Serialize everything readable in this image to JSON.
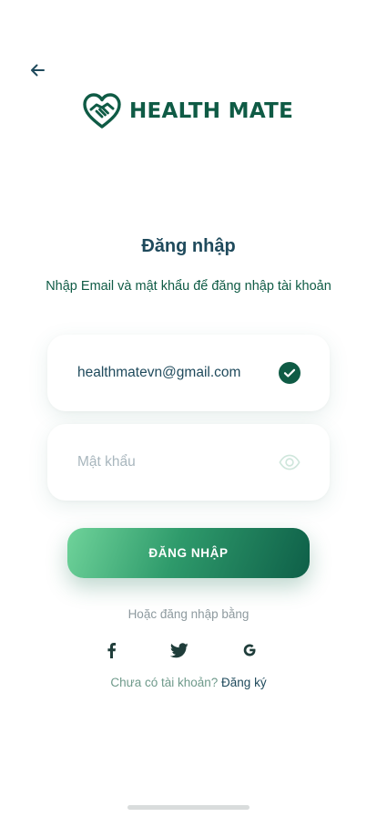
{
  "header": {
    "back_icon": "arrow-left-icon",
    "logo_text": "HEALTH MATE",
    "logo_icon": "heart-handshake-icon",
    "brand_color": "#0f5b45"
  },
  "login": {
    "title": "Đăng nhập",
    "subtitle": "Nhập Email và mật khẩu để đăng nhập tài khoản",
    "email": {
      "value": "healthmatevn@gmail.com",
      "status_icon": "check-circle-icon"
    },
    "password": {
      "placeholder": "Mật khẩu",
      "value": "",
      "toggle_icon": "eye-icon"
    },
    "submit_label": "ĐĂNG NHẬP"
  },
  "social": {
    "label": "Hoặc đăng nhập bằng",
    "providers": [
      {
        "name": "facebook",
        "icon": "facebook-icon"
      },
      {
        "name": "twitter",
        "icon": "twitter-icon"
      },
      {
        "name": "google",
        "icon": "google-icon"
      }
    ]
  },
  "signup": {
    "prompt": "Chưa có tài khoản?",
    "link_label": "Đăng ký"
  }
}
